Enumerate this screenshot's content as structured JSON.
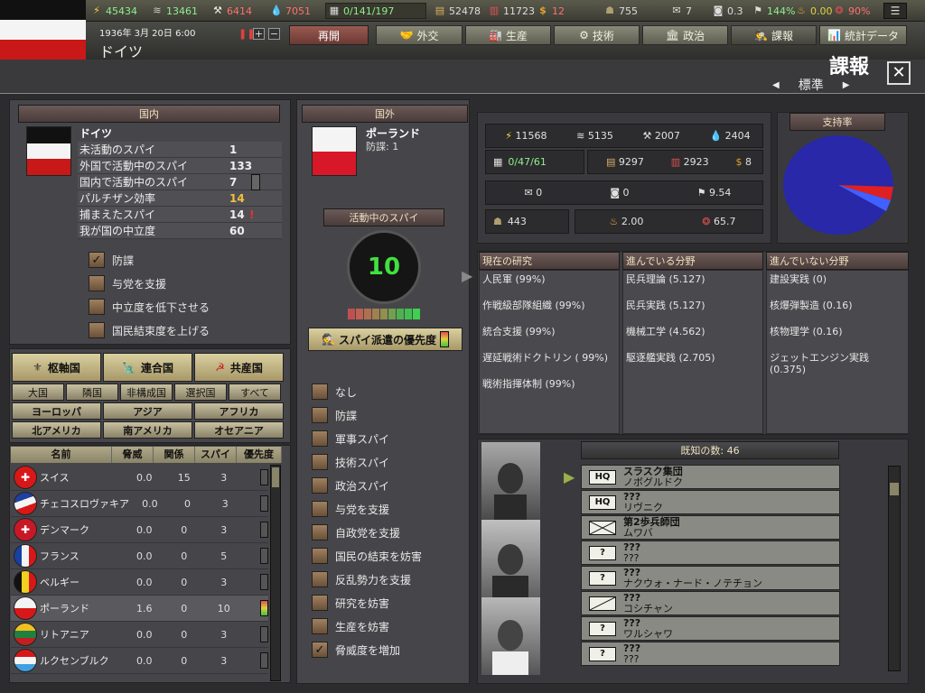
{
  "topbar": {
    "ic": "45434",
    "supplies": "13461",
    "metal": "6414",
    "oil": "7051",
    "officers": "0/141/197",
    "rares": "52478",
    "money": "11723",
    "dollar": "12",
    "manpower": "755",
    "diplo": "7",
    "dissent": "0.3",
    "unity": "144%",
    "esp": "0.00",
    "nu": "90%"
  },
  "header": {
    "date": "1936年 3月 20日 6:00",
    "country": "ドイツ",
    "resume": "再開",
    "title": "課報",
    "view": "標準"
  },
  "tabs": [
    "外交",
    "生産",
    "技術",
    "政治",
    "課報",
    "統計データ"
  ],
  "domestic": {
    "head": "国内",
    "country": "ドイツ",
    "stats": [
      {
        "label": "未活動のスパイ",
        "value": "1"
      },
      {
        "label": "外国で活動中のスパイ",
        "value": "133"
      },
      {
        "label": "国内で活動中のスパイ",
        "value": "7"
      },
      {
        "label": "パルチザン効率",
        "value": "14"
      },
      {
        "label": "捕まえたスパイ",
        "value": "14",
        "mark": "!"
      },
      {
        "label": "我が国の中立度",
        "value": "60"
      }
    ],
    "options": [
      {
        "label": "防諜",
        "checked": true
      },
      {
        "label": "与党を支援",
        "checked": false
      },
      {
        "label": "中立度を低下させる",
        "checked": false
      },
      {
        "label": "国民結束度を上げる",
        "checked": false
      }
    ]
  },
  "filters": {
    "factions": [
      "枢軸国",
      "連合国",
      "共産国"
    ],
    "groups": [
      "大国",
      "隣国",
      "非構成国",
      "選択国",
      "すべて"
    ],
    "continents1": [
      "ヨーロッパ",
      "アジア",
      "アフリカ"
    ],
    "continents2": [
      "北アメリカ",
      "南アメリカ",
      "オセアニア"
    ]
  },
  "table": {
    "headers": [
      "名前",
      "脅威",
      "関係",
      "スパイ",
      "優先度"
    ],
    "rows": [
      {
        "name": "スイス",
        "threat": "0.0",
        "rel": "15",
        "spies": "3"
      },
      {
        "name": "チェコスロヴァキア",
        "threat": "0.0",
        "rel": "0",
        "spies": "3"
      },
      {
        "name": "デンマーク",
        "threat": "0.0",
        "rel": "0",
        "spies": "3"
      },
      {
        "name": "フランス",
        "threat": "0.0",
        "rel": "0",
        "spies": "5"
      },
      {
        "name": "ベルギー",
        "threat": "0.0",
        "rel": "0",
        "spies": "3"
      },
      {
        "name": "ポーランド",
        "threat": "1.6",
        "rel": "0",
        "spies": "10"
      },
      {
        "name": "リトアニア",
        "threat": "0.0",
        "rel": "0",
        "spies": "3"
      },
      {
        "name": "ルクセンブルク",
        "threat": "0.0",
        "rel": "0",
        "spies": "3"
      }
    ]
  },
  "foreign": {
    "head": "国外",
    "country": "ポーランド",
    "ci": "防諜: 1",
    "active_label": "活動中のスパイ",
    "active": "10",
    "priority": "スパイ派遣の優先度",
    "missions": [
      {
        "label": "なし",
        "checked": false
      },
      {
        "label": "防諜",
        "checked": false
      },
      {
        "label": "軍事スパイ",
        "checked": false
      },
      {
        "label": "技術スパイ",
        "checked": false
      },
      {
        "label": "政治スパイ",
        "checked": false
      },
      {
        "label": "与党を支援",
        "checked": false
      },
      {
        "label": "自政党を支援",
        "checked": false
      },
      {
        "label": "国民の結束を妨害",
        "checked": false
      },
      {
        "label": "反乱勢力を支援",
        "checked": false
      },
      {
        "label": "研究を妨害",
        "checked": false
      },
      {
        "label": "生産を妨害",
        "checked": false
      },
      {
        "label": "脅威度を増加",
        "checked": true
      }
    ]
  },
  "target_stats": {
    "ic": "11568",
    "supplies": "5135",
    "metal": "2007",
    "oil": "2404",
    "officers": "0/47/61",
    "rares": "9297",
    "money": "2923",
    "dollar": "8",
    "diplo": "0",
    "dissent": "0",
    "unity": "9.54",
    "manpower": "443",
    "esp": "2.00",
    "nu": "65.7"
  },
  "support": {
    "label": "支持率",
    "colors": [
      "#2828a8",
      "#e02020",
      "#4060ff"
    ]
  },
  "research": {
    "cur_head": "現在の研究",
    "adv_head": "進んでいる分野",
    "lag_head": "進んでいない分野",
    "current": [
      "人民軍 (99%)",
      "作戦級部隊組織 (99%)",
      "統合支援 (99%)",
      "遅延戦術ドクトリン ( 99%)",
      "戦術指揮体制 (99%)"
    ],
    "advanced": [
      "民兵理論 (5.127)",
      "民兵実践 (5.127)",
      "機械工学 (4.562)",
      "駆逐艦実践 (2.705)"
    ],
    "lagging": [
      "建設実践 (0)",
      "核爆弾製造 (0.16)",
      "核物理学 (0.16)",
      "ジェットエンジン実践 (0.375)"
    ]
  },
  "units": {
    "known": "既知の数: 46",
    "list": [
      {
        "icon": "HQ",
        "name": "スラスク集団",
        "loc": "ノボグルドク"
      },
      {
        "icon": "HQ",
        "name": "???",
        "loc": "リヴニク"
      },
      {
        "icon": "X",
        "name": "第2歩兵師団",
        "loc": "ムワバ"
      },
      {
        "icon": "?",
        "name": "???",
        "loc": "???"
      },
      {
        "icon": "?",
        "name": "???",
        "loc": "ナクウォ・ナード・ノテチョン"
      },
      {
        "icon": "/",
        "name": "???",
        "loc": "コシチャン"
      },
      {
        "icon": "?",
        "name": "???",
        "loc": "ワルシャワ"
      },
      {
        "icon": "?",
        "name": "???",
        "loc": "???"
      }
    ]
  }
}
